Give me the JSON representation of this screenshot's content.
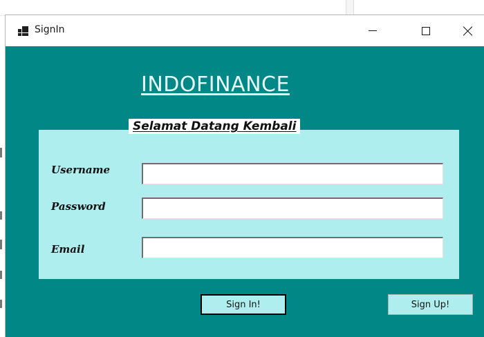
{
  "window": {
    "title": "SignIn",
    "icon": "app-window-icon",
    "controls": {
      "minimize": "minimize-icon",
      "maximize": "maximize-icon",
      "close": "close-icon"
    }
  },
  "form": {
    "heading": "INDOFINANCE",
    "welcome": "Selamat Datang Kembali",
    "fields": [
      {
        "label": "Username",
        "value": ""
      },
      {
        "label": "Password",
        "value": ""
      },
      {
        "label": "Email",
        "value": ""
      }
    ],
    "buttons": {
      "signin": "Sign In!",
      "signup": "Sign Up!"
    }
  },
  "colors": {
    "window_background": "#028787",
    "panel_background": "#afeeee",
    "heading_text": "#e6f8f8"
  }
}
